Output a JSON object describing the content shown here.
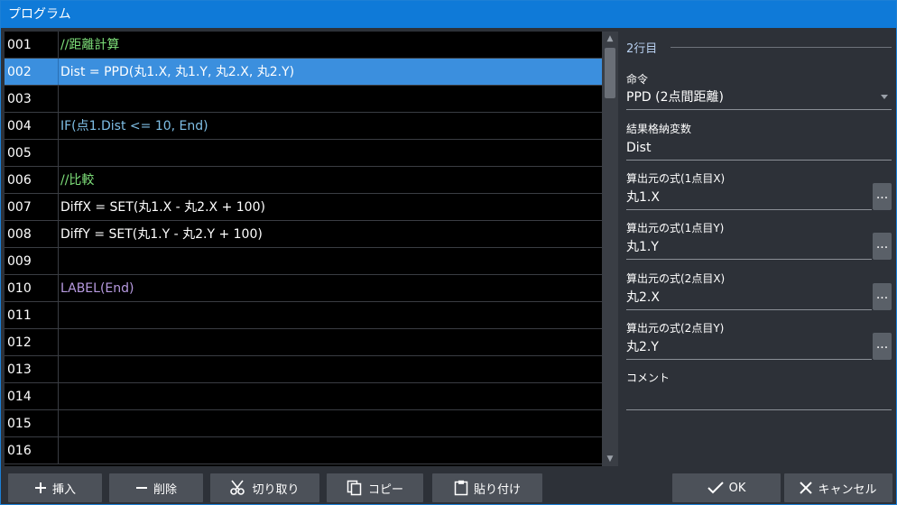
{
  "window": {
    "title": "プログラム"
  },
  "code": {
    "selected_index": 1,
    "rows": [
      {
        "num": "001",
        "text": "//距離計算",
        "style": "comment"
      },
      {
        "num": "002",
        "text": "Dist = PPD(丸1.X, 丸1.Y, 丸2.X, 丸2.Y)",
        "style": "sel"
      },
      {
        "num": "003",
        "text": "",
        "style": "plain"
      },
      {
        "num": "004",
        "text": "IF(点1.Dist <= 10, End)",
        "style": "if"
      },
      {
        "num": "005",
        "text": "",
        "style": "plain"
      },
      {
        "num": "006",
        "text": "//比較",
        "style": "comment"
      },
      {
        "num": "007",
        "text": "DiffX = SET(丸1.X - 丸2.X + 100)",
        "style": "plain"
      },
      {
        "num": "008",
        "text": "DiffY = SET(丸1.Y - 丸2.Y + 100)",
        "style": "plain"
      },
      {
        "num": "009",
        "text": "",
        "style": "plain"
      },
      {
        "num": "010",
        "text": "LABEL(End)",
        "style": "label"
      },
      {
        "num": "011",
        "text": "",
        "style": "plain"
      },
      {
        "num": "012",
        "text": "",
        "style": "plain"
      },
      {
        "num": "013",
        "text": "",
        "style": "plain"
      },
      {
        "num": "014",
        "text": "",
        "style": "plain"
      },
      {
        "num": "015",
        "text": "",
        "style": "plain"
      },
      {
        "num": "016",
        "text": "",
        "style": "plain"
      }
    ]
  },
  "props": {
    "section_title": "2行目",
    "command_label": "命令",
    "command_value": "PPD (2点間距離)",
    "result_label": "結果格納変数",
    "result_value": "Dist",
    "expr1_label": "算出元の式(1点目X)",
    "expr1_value": "丸1.X",
    "expr2_label": "算出元の式(1点目Y)",
    "expr2_value": "丸1.Y",
    "expr3_label": "算出元の式(2点目X)",
    "expr3_value": "丸2.X",
    "expr4_label": "算出元の式(2点目Y)",
    "expr4_value": "丸2.Y",
    "comment_label": "コメント",
    "comment_value": "",
    "dots": "..."
  },
  "buttons": {
    "insert": "挿入",
    "delete": "削除",
    "cut": "切り取り",
    "copy": "コピー",
    "paste": "貼り付け",
    "ok": "OK",
    "cancel": "キャンセル"
  },
  "icons": {
    "insert": "plus-icon",
    "delete": "minus-icon",
    "cut": "scissors-icon",
    "copy": "copy-icon",
    "paste": "clipboard-icon",
    "ok": "check-icon",
    "cancel": "close-icon",
    "scroll_up": "chevron-up-icon",
    "scroll_down": "chevron-down-icon",
    "dropdown": "chevron-down-icon"
  },
  "colors": {
    "titlebar": "#0f7ad8",
    "selection": "#3b8fde",
    "comment": "#7ee07a",
    "if": "#7fbfe6",
    "label": "#b79ae0"
  }
}
